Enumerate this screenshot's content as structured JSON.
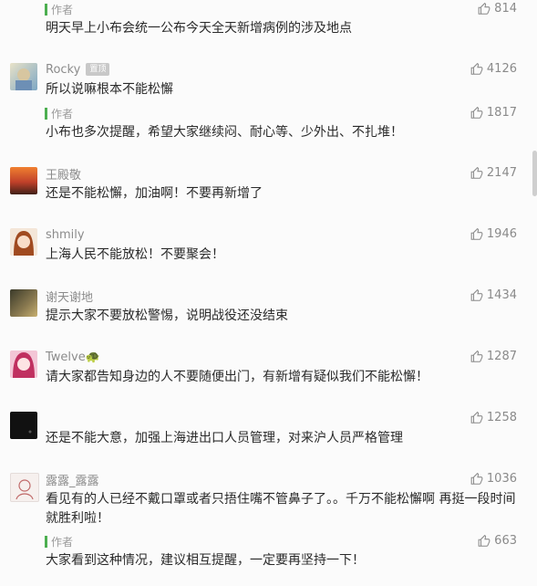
{
  "author_label": "作者",
  "items": [
    {
      "kind": "reply",
      "label": "作者",
      "likes": "814",
      "text": "明天早上小布会统一公布今天全天新增病例的涉及地点"
    },
    {
      "kind": "comment",
      "name": "Rocky",
      "badge": "置顶",
      "likes": "4126",
      "text": "所以说嘛根本不能松懈",
      "avatar": "rocky-avatar"
    },
    {
      "kind": "reply",
      "label": "作者",
      "likes": "1817",
      "text": "小布也多次提醒，希望大家继续闷、耐心等、少外出、不扎堆！"
    },
    {
      "kind": "comment",
      "name": "王殿敬",
      "likes": "2147",
      "text": "还是不能松懈，加油啊！不要再新增了",
      "avatar": "sunset-avatar"
    },
    {
      "kind": "comment",
      "name": "shmily",
      "likes": "1946",
      "text": "上海人民不能放松！不要聚会！",
      "avatar": "girl-avatar"
    },
    {
      "kind": "comment",
      "name": "谢天谢地",
      "likes": "1434",
      "text": "提示大家不要放松警惕，说明战役还没结束",
      "avatar": "photo-avatar"
    },
    {
      "kind": "comment",
      "name": "Twelve🐢",
      "likes": "1287",
      "text": "请大家都告知身边的人不要随便出门，有新增有疑似我们不能松懈！",
      "avatar": "anime-avatar"
    },
    {
      "kind": "comment",
      "name": "",
      "likes": "1258",
      "text": "还是不能大意，加强上海进出口人员管理，对来沪人员严格管理",
      "avatar": "dark-avatar"
    },
    {
      "kind": "comment",
      "name": "露露_露露",
      "likes": "1036",
      "text": "看见有的人已经不戴口罩或者只捂住嘴不管鼻子了。。千万不能松懈啊 再挺一段时间就胜利啦！",
      "avatar": "sketch-avatar"
    },
    {
      "kind": "reply",
      "label": "作者",
      "likes": "663",
      "text": "大家看到这种情况，建议相互提醒，一定要再坚持一下！"
    }
  ],
  "colors": {
    "author_bar": "#4caf50",
    "meta_gray": "#8c8c8c",
    "text": "#2a2a2a",
    "background": "#fbfbfb"
  }
}
